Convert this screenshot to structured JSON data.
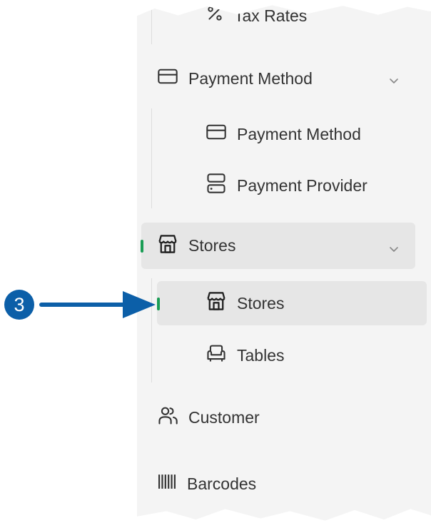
{
  "menu": {
    "tax_rates": {
      "label": "Tax Rates"
    },
    "payment_group": {
      "label": "Payment Method",
      "children": [
        {
          "label": "Payment Method"
        },
        {
          "label": "Payment Provider"
        }
      ]
    },
    "stores_group": {
      "label": "Stores",
      "children": [
        {
          "label": "Stores"
        },
        {
          "label": "Tables"
        }
      ]
    },
    "customer": {
      "label": "Customer"
    },
    "barcodes": {
      "label": "Barcodes"
    }
  },
  "callout": {
    "number": "3"
  },
  "colors": {
    "accent": "#1a9d55",
    "callout": "#0c5fa8",
    "panel_bg": "#f4f4f4",
    "active_bg": "#e6e6e6"
  },
  "icons": {
    "tax_rates": "percent-icon",
    "payment": "credit-card-icon",
    "provider": "server-icon",
    "stores": "store-icon",
    "tables": "armchair-icon",
    "customer": "users-icon",
    "barcodes": "barcode-icon"
  }
}
